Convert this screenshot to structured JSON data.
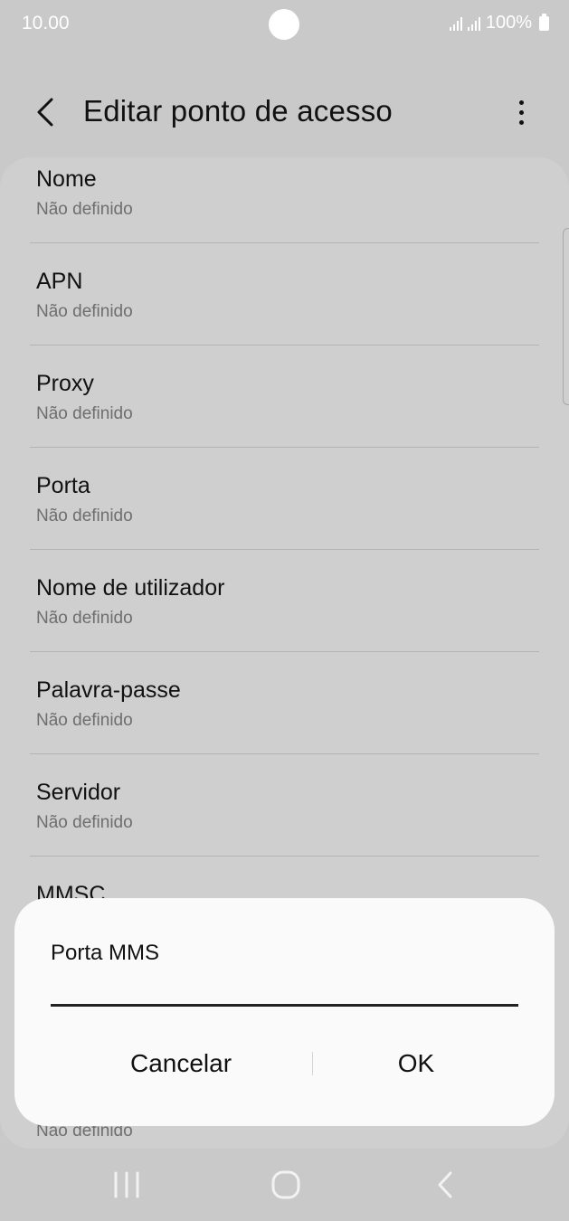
{
  "status_bar": {
    "time": "10.00",
    "battery": "100%"
  },
  "header": {
    "title": "Editar ponto de acesso"
  },
  "list": {
    "items": [
      {
        "label": "Nome",
        "value": "Não definido"
      },
      {
        "label": "APN",
        "value": "Não definido"
      },
      {
        "label": "Proxy",
        "value": "Não definido"
      },
      {
        "label": "Porta",
        "value": "Não definido"
      },
      {
        "label": "Nome de utilizador",
        "value": "Não definido"
      },
      {
        "label": "Palavra-passe",
        "value": "Não definido"
      },
      {
        "label": "Servidor",
        "value": "Não definido"
      },
      {
        "label": "MMSC",
        "value": ""
      }
    ],
    "partial_value": "Não definido"
  },
  "dialog": {
    "title": "Porta MMS",
    "input_value": "",
    "cancel_label": "Cancelar",
    "ok_label": "OK"
  },
  "icons": {
    "back": "back-arrow-icon",
    "more": "more-vertical-icon",
    "recents": "recents-icon",
    "home": "home-icon",
    "nav_back": "nav-back-icon"
  }
}
